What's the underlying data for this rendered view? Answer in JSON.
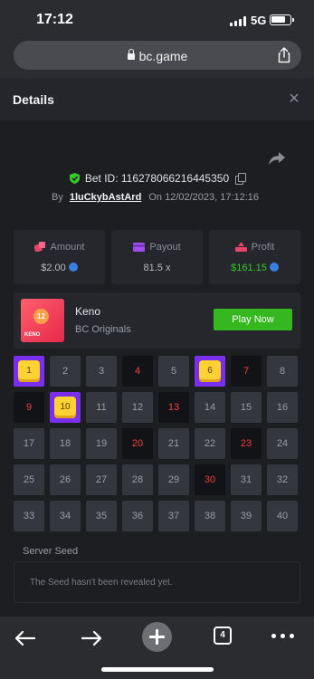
{
  "status_bar": {
    "time": "17:12",
    "network": "5G",
    "battery_level": 0.8
  },
  "browser": {
    "url": "bc.game",
    "tab_count": "4"
  },
  "modal": {
    "title": "Details",
    "close_label": "×"
  },
  "bet": {
    "bet_id_text": "Bet ID: 116278066216445350",
    "by_label": "By",
    "username": "1luCkybAstArd",
    "on_label": "On",
    "datetime": "12/02/2023, 17:12:16"
  },
  "stats": {
    "amount": {
      "label": "Amount",
      "value": "$2.00"
    },
    "payout": {
      "label": "Payout",
      "value": "81.5 x"
    },
    "profit": {
      "label": "Profit",
      "value": "$161.15"
    }
  },
  "game": {
    "name": "Keno",
    "provider": "BC Originals",
    "play_label": "Play Now",
    "thumb_number": "12",
    "thumb_label": "KENO"
  },
  "keno": {
    "numbers": [
      "1",
      "2",
      "3",
      "4",
      "5",
      "6",
      "7",
      "8",
      "9",
      "10",
      "11",
      "12",
      "13",
      "14",
      "15",
      "16",
      "17",
      "18",
      "19",
      "20",
      "21",
      "22",
      "23",
      "24",
      "25",
      "26",
      "27",
      "28",
      "29",
      "30",
      "31",
      "32",
      "33",
      "34",
      "35",
      "36",
      "37",
      "38",
      "39",
      "40"
    ],
    "hit": [
      "1",
      "6",
      "10"
    ],
    "drawn_miss": [
      "4",
      "7",
      "9",
      "13",
      "20",
      "23",
      "30"
    ]
  },
  "seed": {
    "label": "Server Seed",
    "text": "The Seed hasn't been revealed yet."
  },
  "colors": {
    "accent_green": "#35b71f",
    "profit_green": "#35c92a",
    "hit_purple": "#7b2fee",
    "gem_yellow": "#ffd233",
    "miss_red": "#f04040"
  }
}
